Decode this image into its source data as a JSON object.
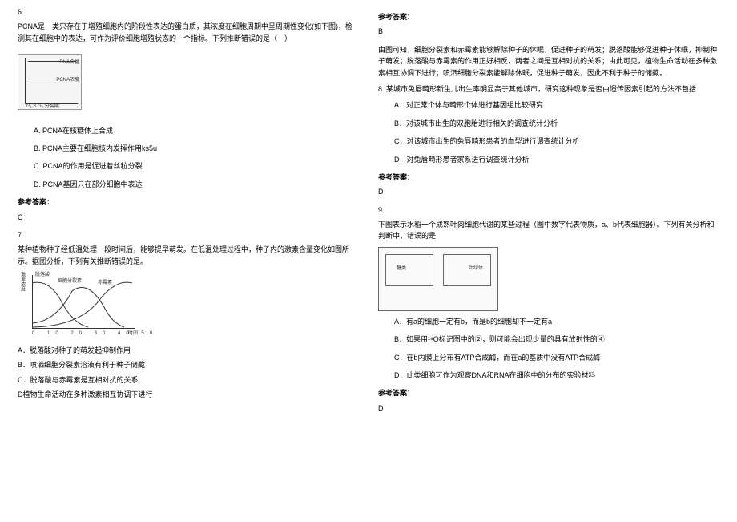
{
  "left": {
    "q6": {
      "num": "6.",
      "text": "PCNA是一类只存在于增殖细胞内的阶段性表达的蛋白质，其浓度在细胞周期中呈周期性变化(如下图)，检测其在细胞中的表达，可作为评价细胞增殖状态的一个指标。下列推断错误的是（　）",
      "fig": {
        "dna": "DNA含量",
        "pcna": "PCNA浓度",
        "axis": "G₁  S  G₂  分裂期"
      },
      "opts": {
        "a": "A. PCNA在核糖体上合成",
        "b": "B. PCNA主要在细胞核内发挥作用ks5u",
        "c": "C. PCNA的作用是促进着丝粒分裂",
        "d": "D. PCNA基因只在部分细胞中表达"
      },
      "ansH": "参考答案：",
      "ansV": "C"
    },
    "q7": {
      "num": "7.",
      "text": "某种植物种子经低温处理一段时间后，能够提早萌发。在低温处理过程中，种子内的激素含量变化如图所示。据图分析，下列有关推断错误的是。",
      "fig": {
        "y": "激素浓度",
        "legend1": "脱落酸",
        "legend2": "细胞分裂素",
        "legend3": "赤霉素",
        "ticks": "0 10 20 30 40 50",
        "x": "时间"
      },
      "opts": {
        "a": "A．脱落酸对种子的萌发起抑制作用",
        "b": "B．喷洒细胞分裂素溶液有利于种子储藏",
        "c": "C．脱落酸与赤霉素是互相对抗的关系",
        "d": "D植物生命活动在多种激素相互协调下进行"
      }
    }
  },
  "right": {
    "q7ans": {
      "ansH": "参考答案：",
      "ansV": "B",
      "expl": "由图可知，细胞分裂素和赤霉素能够解除种子的休眠，促进种子的萌发；脱落酸能够促进种子休眠，抑制种子萌发；脱落酸与赤霉素的作用正好相反，两者之间是互相对抗的关系；由此可见，植物生命活动在多种激素相互协调下进行；喷洒细胞分裂素能解除休眠，促进种子萌发，因此不利于种子的储藏。"
    },
    "q8": {
      "text": "8. 某城市兔唇畸形新生儿出生率明显高于其他城市，研究这种现象是否由遗传因素引起的方法不包括",
      "opts": {
        "a": "A．对正常个体与畸形个体进行基因组比较研究",
        "b": "B．对该城市出生的双胞胎进行相关的调查统计分析",
        "c": "C．对该城市出生的兔唇畸形患者的血型进行调查统计分析",
        "d": "D．对兔唇畸形患者家系进行调查统计分析"
      },
      "ansH": "参考答案：",
      "ansV": "D"
    },
    "q9": {
      "num": "9.",
      "text": "下图表示水稻一个成熟叶肉细胞代谢的某些过程（图中数字代表物质，a、b代表细胞器）。下列有关分析和判断中，错误的是",
      "fig": {
        "lbl1": "糖类",
        "lbl2": "叶绿体"
      },
      "opts": {
        "a": "A．有a的细胞一定有b，而是b的细胞却不一定有a",
        "b": "B．如果用¹⁸O标记图中的②，则可能会出现少量的具有放射性的④",
        "c": "C．在b内膜上分布有ATP合成酶，而在a的基质中没有ATP合成酶",
        "d": "D．此类细胞可作为观察DNA和RNA在细胞中的分布的实验材料"
      },
      "ansH": "参考答案：",
      "ansV": "D"
    }
  }
}
